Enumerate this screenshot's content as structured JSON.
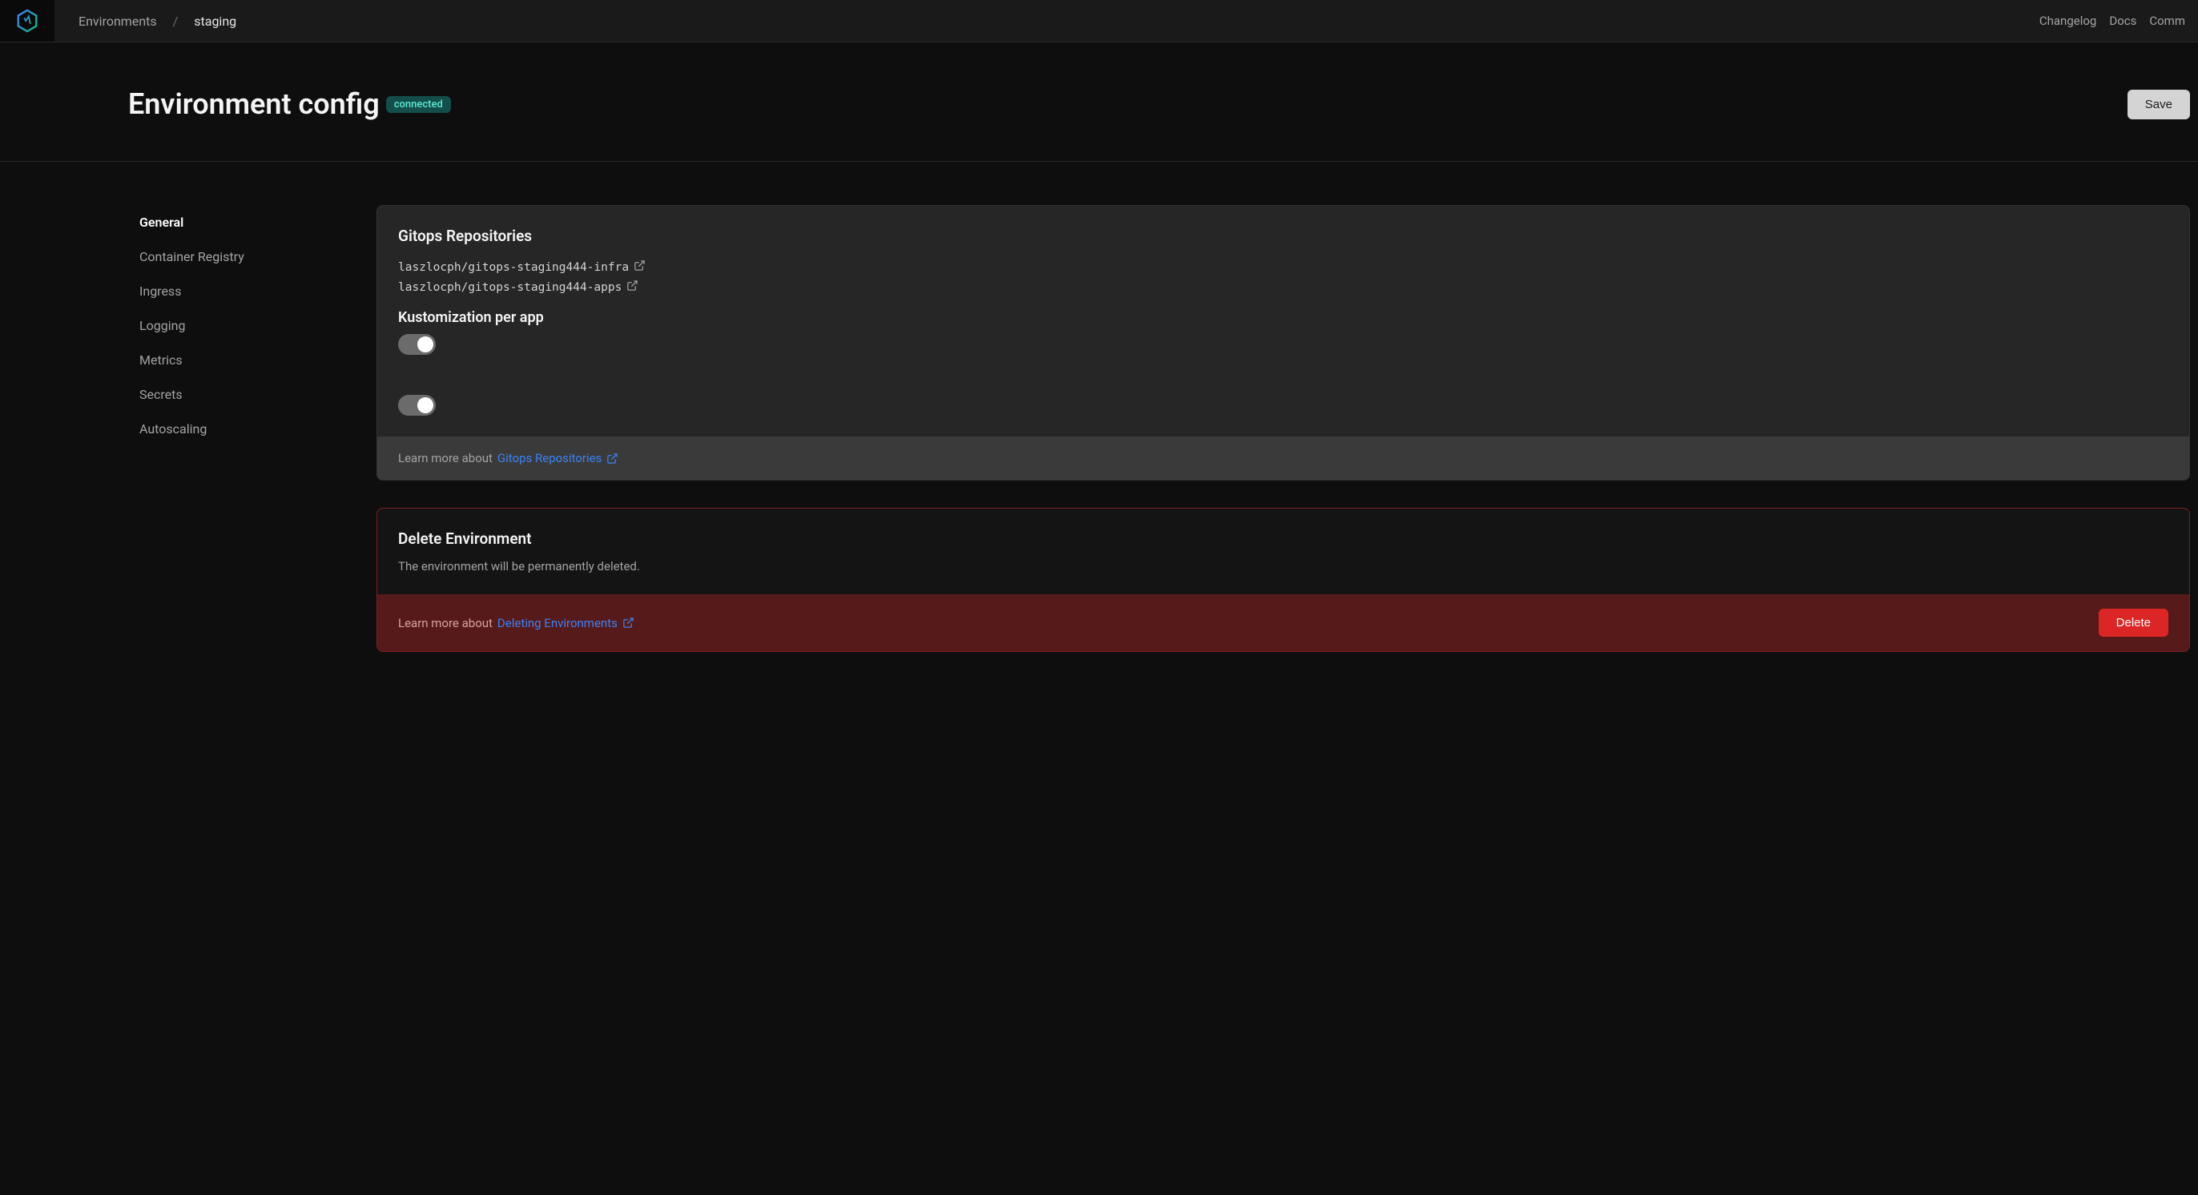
{
  "topbar": {
    "breadcrumb": {
      "root": "Environments",
      "separator": "/",
      "current": "staging"
    },
    "nav": {
      "changelog": "Changelog",
      "docs": "Docs",
      "community": "Comm"
    }
  },
  "header": {
    "title": "Environment config",
    "status": "connected",
    "save_label": "Save"
  },
  "sidebar": {
    "items": [
      {
        "label": "General",
        "active": true
      },
      {
        "label": "Container Registry",
        "active": false
      },
      {
        "label": "Ingress",
        "active": false
      },
      {
        "label": "Logging",
        "active": false
      },
      {
        "label": "Metrics",
        "active": false
      },
      {
        "label": "Secrets",
        "active": false
      },
      {
        "label": "Autoscaling",
        "active": false
      }
    ]
  },
  "gitops": {
    "title": "Gitops Repositories",
    "repos": [
      "laszlocph/gitops-staging444-infra",
      "laszlocph/gitops-staging444-apps"
    ],
    "kustomization_title": "Kustomization per app",
    "footer_prefix": "Learn more about",
    "footer_link": "Gitops Repositories"
  },
  "delete": {
    "title": "Delete Environment",
    "description": "The environment will be permanently deleted.",
    "footer_prefix": "Learn more about",
    "footer_link": "Deleting Environments",
    "button_label": "Delete"
  }
}
